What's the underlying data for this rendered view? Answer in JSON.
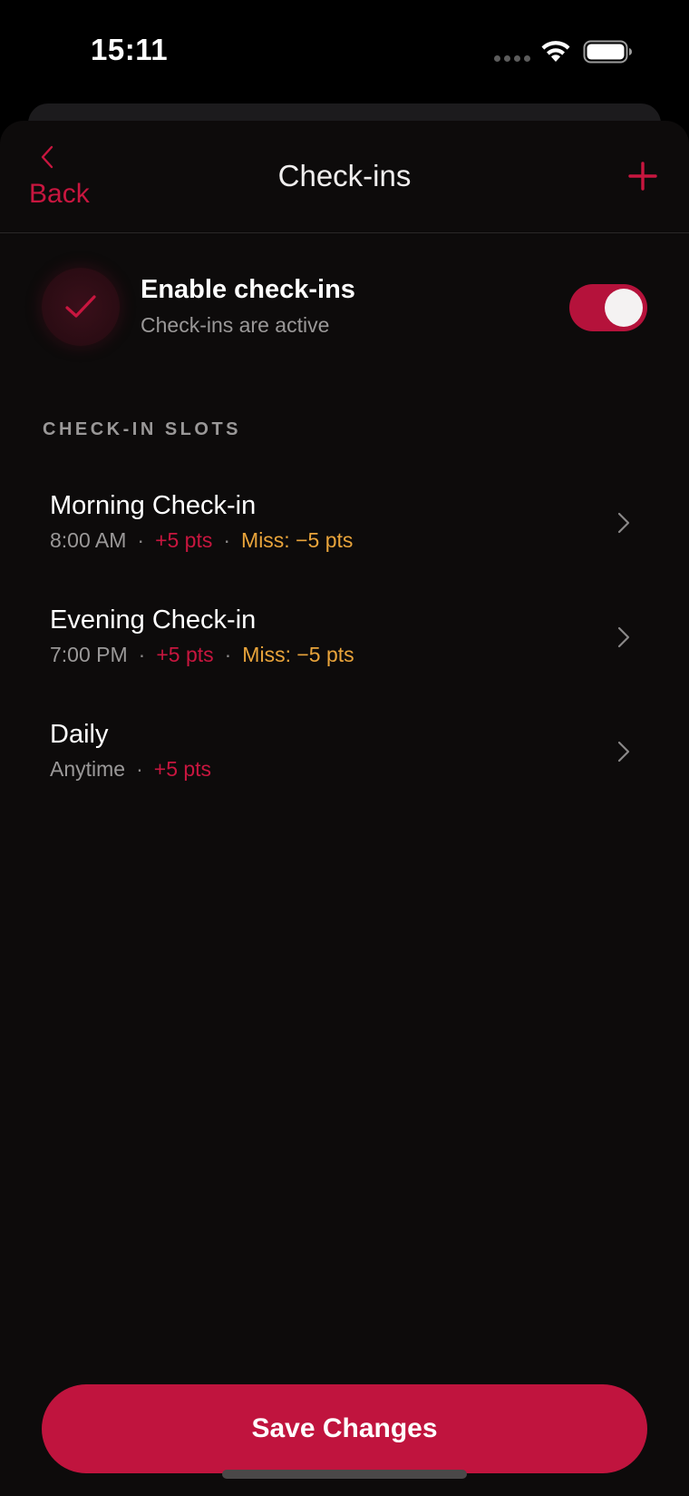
{
  "status_bar": {
    "time": "15:11"
  },
  "nav": {
    "back_label": "Back",
    "title": "Check-ins",
    "add_icon": "plus-icon"
  },
  "enable": {
    "title": "Enable check-ins",
    "subtitle": "Check-ins are active",
    "enabled": true
  },
  "section_header": "CHECK-IN SLOTS",
  "slots": [
    {
      "title": "Morning Check-in",
      "time": "8:00 AM",
      "points": "+5 pts",
      "miss": "Miss: −5 pts"
    },
    {
      "title": "Evening Check-in",
      "time": "7:00 PM",
      "points": "+5 pts",
      "miss": "Miss: −5 pts"
    },
    {
      "title": "Daily",
      "time": "Anytime",
      "points": "+5 pts"
    }
  ],
  "save_label": "Save Changes",
  "colors": {
    "accent": "#c0143e",
    "miss": "#e9a43b",
    "background": "#0d0b0b",
    "secondary_text": "#9a9898"
  }
}
